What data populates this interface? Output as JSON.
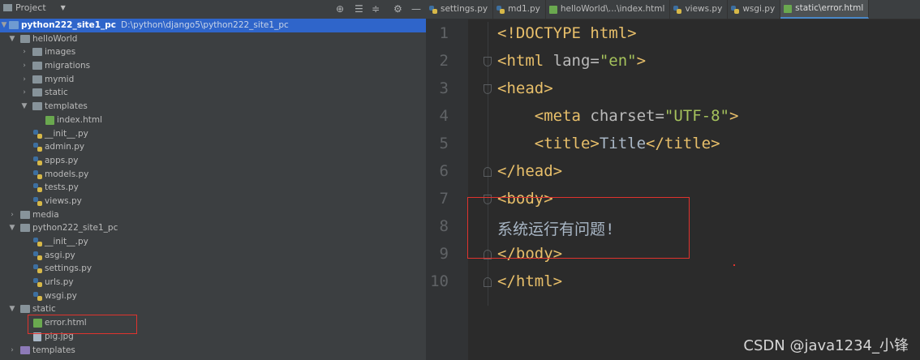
{
  "panel": {
    "title": "Project",
    "dropdown_icon": "chevron-down-icon",
    "tools": [
      "crosshair-icon",
      "expand-all-icon",
      "collapse-all-icon",
      "gear-icon",
      "minimize-icon"
    ]
  },
  "tree": {
    "root": {
      "name": "python222_site1_pc",
      "path": "D:\\python\\django5\\python222_site1_pc"
    },
    "items": [
      {
        "label": "helloWorld"
      },
      {
        "label": "images"
      },
      {
        "label": "migrations"
      },
      {
        "label": "mymid"
      },
      {
        "label": "static"
      },
      {
        "label": "templates"
      },
      {
        "label": "index.html"
      },
      {
        "label": "__init__.py"
      },
      {
        "label": "admin.py"
      },
      {
        "label": "apps.py"
      },
      {
        "label": "models.py"
      },
      {
        "label": "tests.py"
      },
      {
        "label": "views.py"
      },
      {
        "label": "media"
      },
      {
        "label": "python222_site1_pc"
      },
      {
        "label": "__init__.py"
      },
      {
        "label": "asgi.py"
      },
      {
        "label": "settings.py"
      },
      {
        "label": "urls.py"
      },
      {
        "label": "wsgi.py"
      },
      {
        "label": "static"
      },
      {
        "label": "error.html"
      },
      {
        "label": "pig.jpg"
      },
      {
        "label": "templates"
      }
    ]
  },
  "tabs": [
    {
      "label": "settings.py"
    },
    {
      "label": "md1.py"
    },
    {
      "label": "helloWorld\\...\\index.html"
    },
    {
      "label": "views.py"
    },
    {
      "label": "wsgi.py"
    },
    {
      "label": "static\\error.html"
    }
  ],
  "editor": {
    "line_numbers": [
      "1",
      "2",
      "3",
      "4",
      "5",
      "6",
      "7",
      "8",
      "9",
      "10"
    ],
    "code": {
      "l1": "<!DOCTYPE html>",
      "l2_open": "<html",
      "l2_attr": " lang=",
      "l2_str": "\"en\"",
      "l2_close": ">",
      "l3": "<head>",
      "l4_open": "<meta",
      "l4_attr": " charset=",
      "l4_str": "\"UTF-8\"",
      "l4_close": ">",
      "l5_open": "<title>",
      "l5_text": "Title",
      "l5_close": "</title>",
      "l6": "</head>",
      "l7": "<body>",
      "l8": "系统运行有问题!",
      "l9": "</body>",
      "l10": "</html>"
    }
  },
  "watermark": "CSDN @java1234_小锋",
  "colors": {
    "selection": "#2f65ca",
    "highlight_box": "#e0332e",
    "tag": "#e8bf6a",
    "string": "#a5c25c"
  }
}
